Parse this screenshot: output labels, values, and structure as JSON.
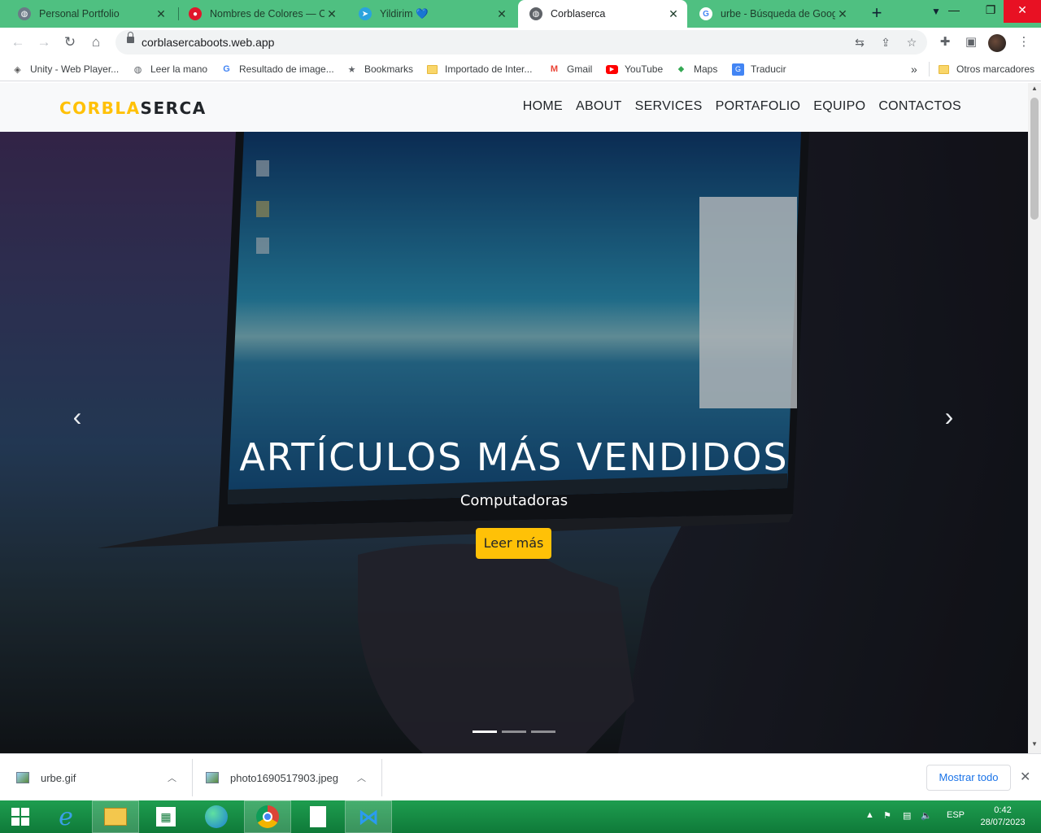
{
  "browser": {
    "tabs": [
      {
        "title": "Personal Portfolio",
        "favicon": "globe-icon",
        "active": false
      },
      {
        "title": "Nombres de Colores — Có",
        "favicon": "red-circle-icon",
        "active": false
      },
      {
        "title": "Yildirim 💙",
        "favicon": "telegram-icon",
        "active": false
      },
      {
        "title": "Corblaserca",
        "favicon": "globe-icon",
        "active": true
      },
      {
        "title": "urbe - Búsqueda de Google",
        "favicon": "google-icon",
        "active": false
      }
    ],
    "address": "corblasercaboots.web.app",
    "bookmarks": [
      {
        "label": "Unity - Web Player...",
        "icon": "unity-icon"
      },
      {
        "label": "Leer la mano",
        "icon": "globe-icon"
      },
      {
        "label": "Resultado de image...",
        "icon": "google-icon"
      },
      {
        "label": "Bookmarks",
        "icon": "star-icon"
      },
      {
        "label": "Importado de Inter...",
        "icon": "folder-icon"
      },
      {
        "label": "Gmail",
        "icon": "gmail-icon"
      },
      {
        "label": "YouTube",
        "icon": "youtube-icon"
      },
      {
        "label": "Maps",
        "icon": "maps-icon"
      },
      {
        "label": "Traducir",
        "icon": "translate-icon"
      }
    ],
    "other_bookmarks": "Otros marcadores"
  },
  "site": {
    "brand_part1": "CORBLA",
    "brand_part2": "SERCA",
    "menu": [
      "HOME",
      "ABOUT",
      "SERVICES",
      "PORTAFOLIO",
      "EQUIPO",
      "CONTACTOS"
    ],
    "hero": {
      "title": "ARTÍCULOS MÁS VENDIDOS",
      "subtitle": "Computadoras",
      "button": "Leer más",
      "slides": 3,
      "active_slide": 1
    },
    "colors": {
      "accent": "#ffc107",
      "navbar_bg": "#f8f9fa",
      "text_dark": "#212529"
    }
  },
  "downloads": {
    "items": [
      {
        "name": "urbe.gif"
      },
      {
        "name": "photo1690517903.jpeg"
      }
    ],
    "show_all": "Mostrar todo"
  },
  "taskbar": {
    "language": "ESP",
    "time": "0:42",
    "date": "28/07/2023"
  }
}
